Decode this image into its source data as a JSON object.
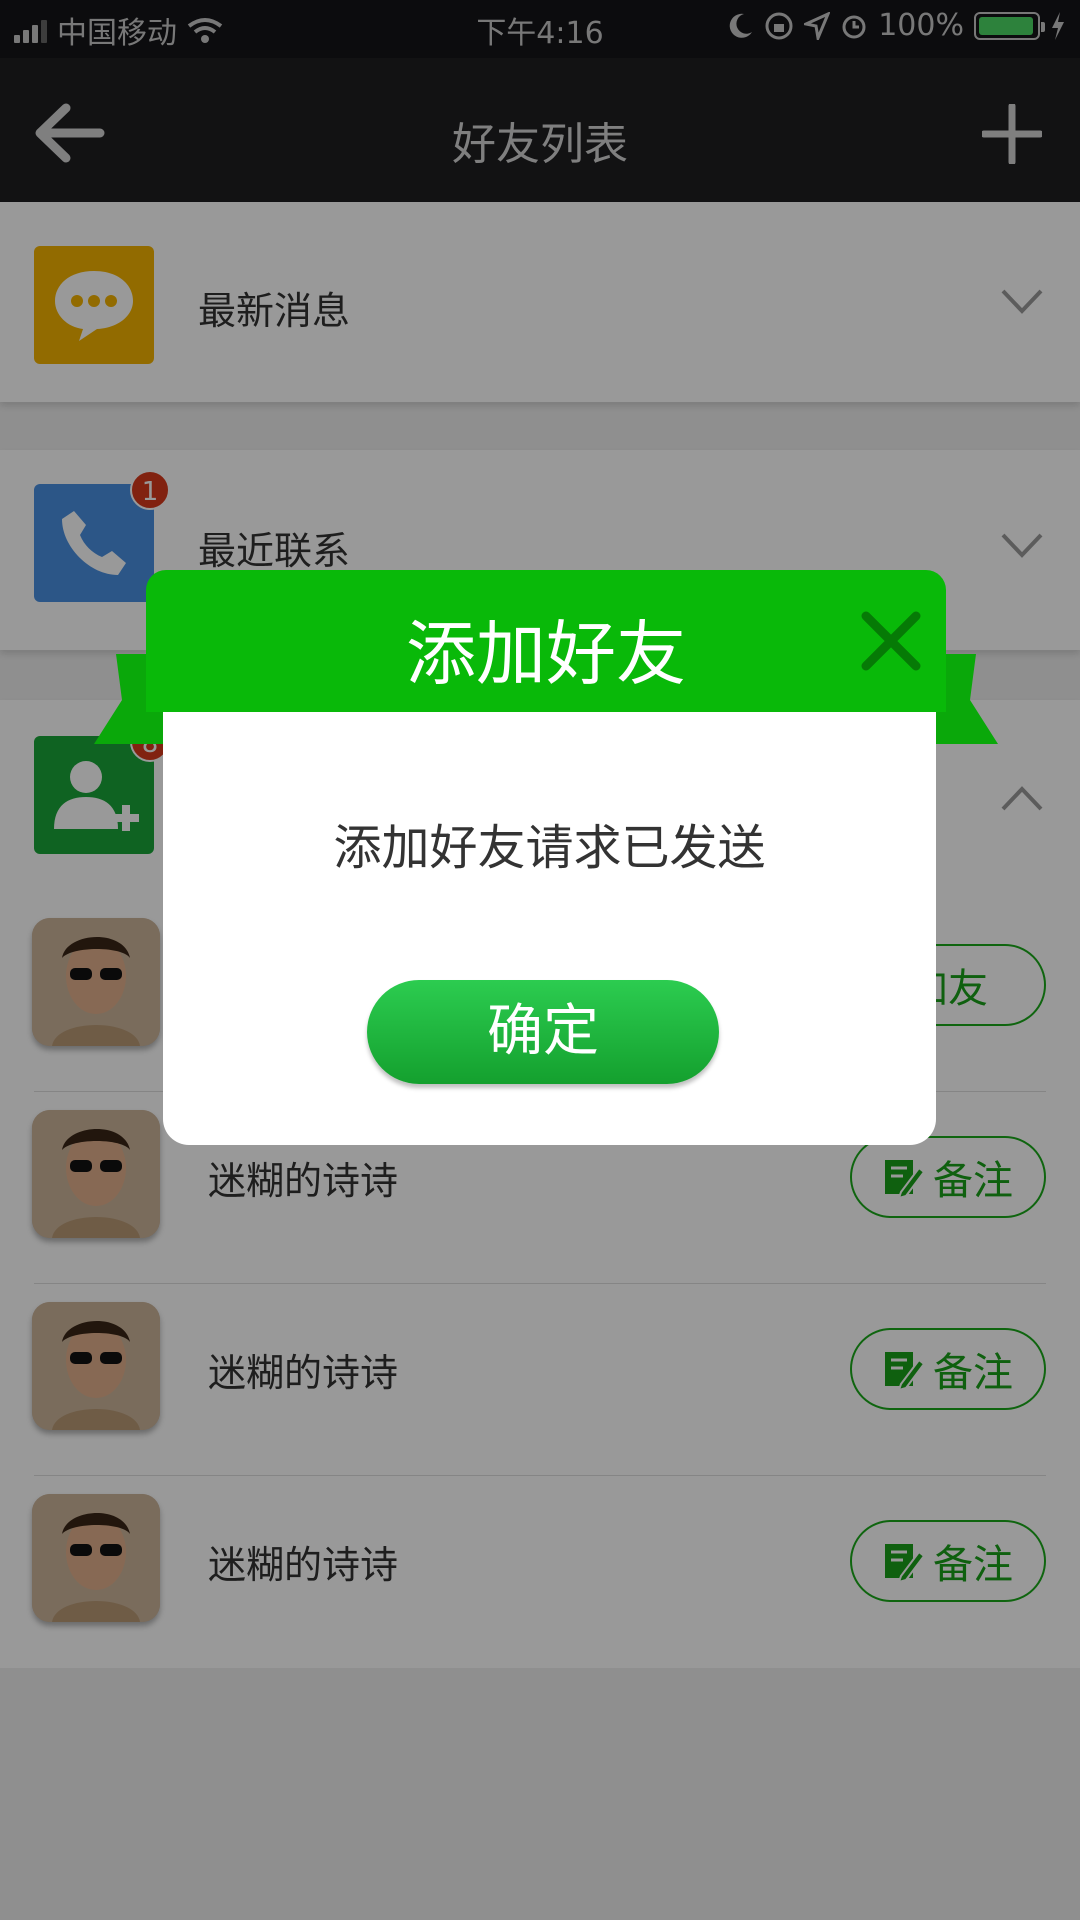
{
  "status_bar": {
    "carrier": "中国移动",
    "time": "下午4:16",
    "battery": "100%",
    "battery_level": 1.0
  },
  "nav": {
    "title": "好友列表",
    "back_icon": "arrow-left-icon",
    "add_icon": "plus-icon"
  },
  "sections": [
    {
      "label": "最新消息",
      "icon": "chat-bubble-icon",
      "color": "#f4b300",
      "badge": "",
      "expanded": false
    },
    {
      "label": "最近联系",
      "icon": "phone-icon",
      "color": "#4a90e2",
      "badge": "1",
      "expanded": false
    },
    {
      "label": "",
      "icon": "add-user-icon",
      "color": "#1aa53a",
      "badge": "8",
      "expanded": true
    }
  ],
  "friends": [
    {
      "name": "",
      "button": "加友"
    },
    {
      "name": "迷糊的诗诗",
      "button": "备注"
    },
    {
      "name": "迷糊的诗诗",
      "button": "备注"
    },
    {
      "name": "迷糊的诗诗",
      "button": "备注"
    }
  ],
  "dialog": {
    "title": "添加好友",
    "message": "添加好友请求已发送",
    "confirm": "确定",
    "header_color": "#09b909"
  },
  "colors": {
    "accent_green": "#1aa81a",
    "badge_red": "#d83a1c",
    "nav_bg": "#1e1e21"
  }
}
